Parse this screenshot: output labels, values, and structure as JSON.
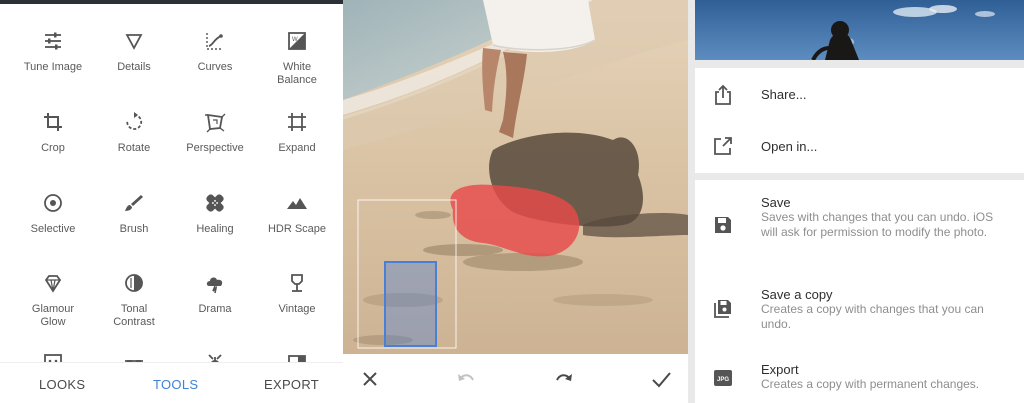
{
  "tools": [
    {
      "label": "Tune Image",
      "icon": "tune-image-icon"
    },
    {
      "label": "Details",
      "icon": "details-icon"
    },
    {
      "label": "Curves",
      "icon": "curves-icon"
    },
    {
      "label": "White\nBalance",
      "icon": "white-balance-icon"
    },
    {
      "label": "Crop",
      "icon": "crop-icon"
    },
    {
      "label": "Rotate",
      "icon": "rotate-icon"
    },
    {
      "label": "Perspective",
      "icon": "perspective-icon"
    },
    {
      "label": "Expand",
      "icon": "expand-icon"
    },
    {
      "label": "Selective",
      "icon": "selective-icon"
    },
    {
      "label": "Brush",
      "icon": "brush-icon"
    },
    {
      "label": "Healing",
      "icon": "healing-icon"
    },
    {
      "label": "HDR Scape",
      "icon": "hdr-scape-icon"
    },
    {
      "label": "Glamour\nGlow",
      "icon": "glamour-glow-icon"
    },
    {
      "label": "Tonal\nContrast",
      "icon": "tonal-contrast-icon"
    },
    {
      "label": "Drama",
      "icon": "drama-icon"
    },
    {
      "label": "Vintage",
      "icon": "vintage-icon"
    }
  ],
  "bottom_nav": {
    "looks": "LOOKS",
    "tools": "TOOLS",
    "export": "EXPORT",
    "active": "TOOLS"
  },
  "editor_bar": {
    "cancel_icon": "close-icon",
    "undo_icon": "undo-icon",
    "redo_icon": "redo-icon",
    "apply_icon": "checkmark-icon"
  },
  "export_menu": {
    "share": {
      "title": "Share...",
      "icon": "share-icon"
    },
    "open_in": {
      "title": "Open in...",
      "icon": "open-in-icon"
    },
    "save": {
      "title": "Save",
      "description": "Saves with changes that you can undo. iOS will ask for permission to modify the photo.",
      "icon": "save-icon"
    },
    "save_copy": {
      "title": "Save a copy",
      "description": "Creates a copy with changes that you can undo.",
      "icon": "save-copy-icon"
    },
    "export": {
      "title": "Export",
      "description": "Creates a copy with permanent changes.",
      "icon": "jpg-icon",
      "badge": "JPG"
    }
  },
  "colors": {
    "accent": "#3f82d6",
    "healing_mask": "#e84b4b",
    "selection": "#4a7fd8"
  }
}
